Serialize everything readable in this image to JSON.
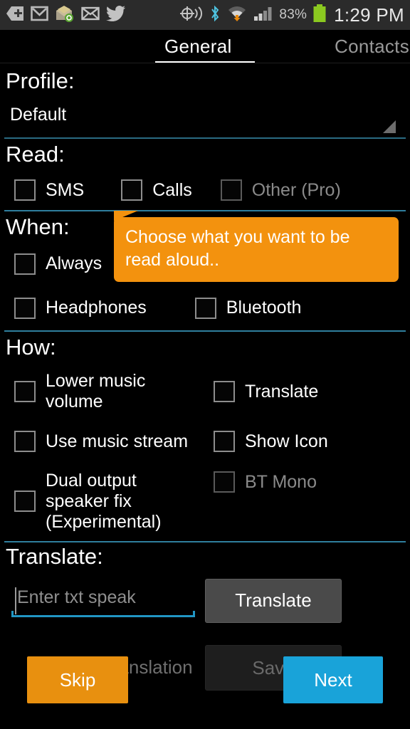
{
  "statusbar": {
    "icons": [
      "download-plus-icon",
      "gmail-icon",
      "mail-badge-icon",
      "envelope-icon",
      "twitter-icon",
      "location-icon",
      "bluetooth-icon",
      "wifi-icon",
      "signal-icon"
    ],
    "battery_percent": "83%",
    "time": "1:29 PM"
  },
  "tabs": [
    {
      "label": "General",
      "active": true
    },
    {
      "label": "Contacts",
      "active": false
    }
  ],
  "sections": {
    "profile": {
      "title": "Profile:",
      "value": "Default"
    },
    "read": {
      "title": "Read:",
      "items": [
        {
          "label": "SMS",
          "checked": false,
          "enabled": true
        },
        {
          "label": "Calls",
          "checked": false,
          "enabled": true
        },
        {
          "label": "Other (Pro)",
          "checked": false,
          "enabled": false
        }
      ]
    },
    "when": {
      "title": "When:",
      "items": [
        {
          "label": "Always",
          "checked": false,
          "enabled": true
        },
        {
          "label": "Headphones",
          "checked": false,
          "enabled": true
        },
        {
          "label": "Bluetooth",
          "checked": false,
          "enabled": true
        }
      ]
    },
    "how": {
      "title": "How:",
      "items": [
        {
          "label": "Lower music volume",
          "checked": false,
          "enabled": true
        },
        {
          "label": "Translate",
          "checked": false,
          "enabled": true
        },
        {
          "label": "Use music stream",
          "checked": false,
          "enabled": true
        },
        {
          "label": "Show Icon",
          "checked": false,
          "enabled": true
        },
        {
          "label": "Dual output speaker fix (Experimental)",
          "checked": false,
          "enabled": true
        },
        {
          "label": "BT Mono",
          "checked": false,
          "enabled": false
        }
      ]
    },
    "translate": {
      "title": "Translate:",
      "input_value": "",
      "input_placeholder": "Enter txt speak",
      "button_label": "Translate"
    }
  },
  "tooltip": {
    "text": "Choose what you want to be read aloud..",
    "color": "#f3920e"
  },
  "bottom": {
    "hint_text": "Enter Translation",
    "save_label": "Save",
    "skip_label": "Skip",
    "next_label": "Next",
    "next_color": "#19a3d9",
    "skip_color": "#e8900f"
  }
}
